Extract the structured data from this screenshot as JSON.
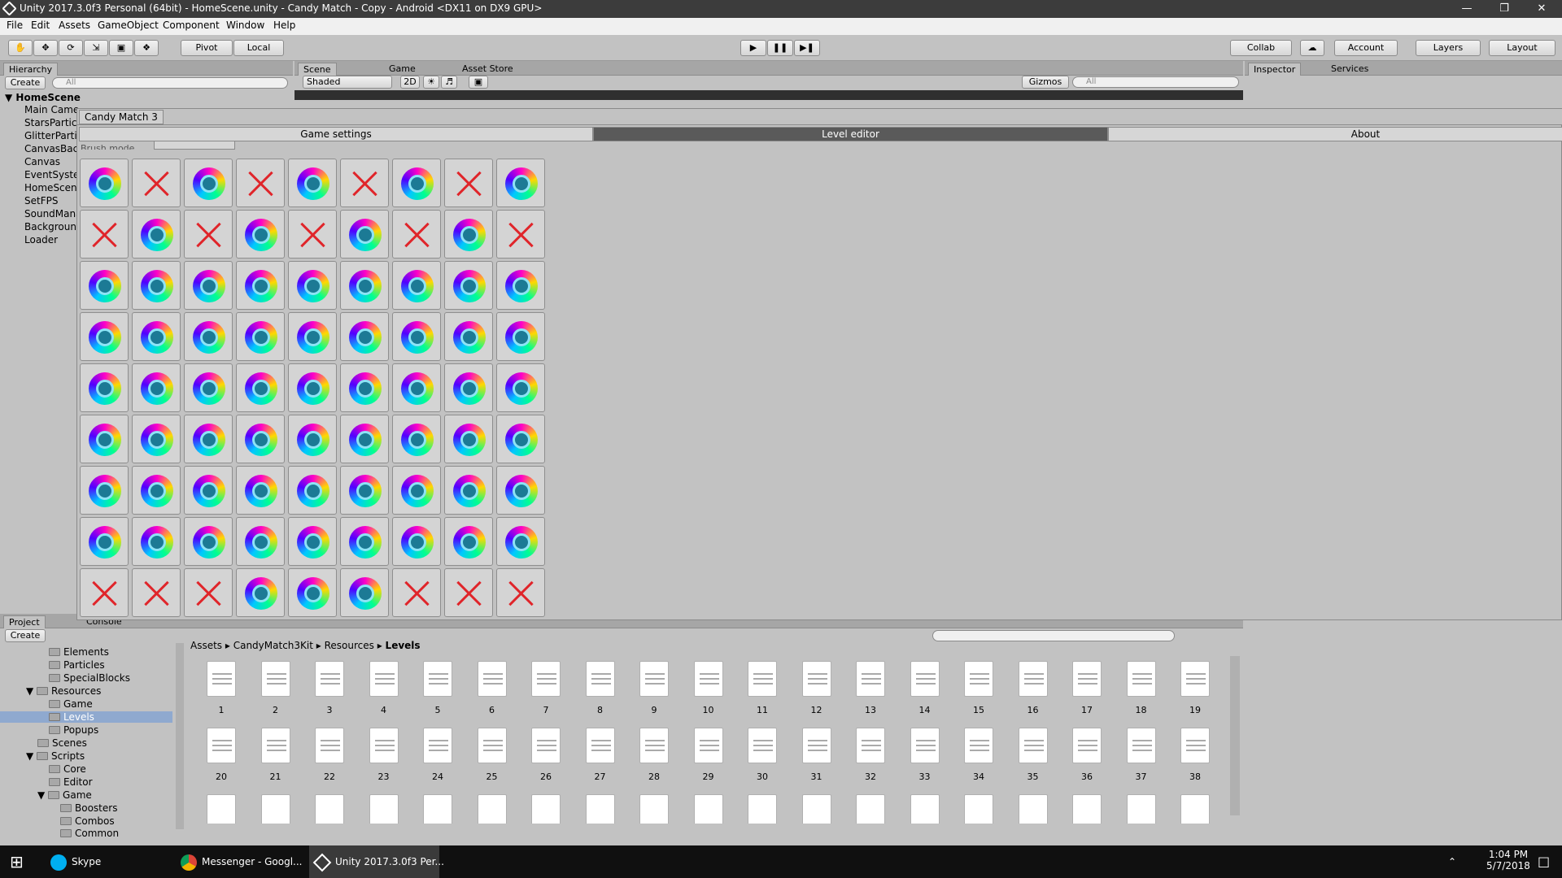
{
  "window": {
    "title": "Unity 2017.3.0f3 Personal (64bit) - HomeScene.unity - Candy Match - Copy - Android <DX11 on DX9 GPU>"
  },
  "menu": [
    "File",
    "Edit",
    "Assets",
    "GameObject",
    "Component",
    "Window",
    "Help"
  ],
  "toolbar": {
    "pivot": "Pivot",
    "local": "Local",
    "collab": "Collab",
    "account": "Account",
    "layers": "Layers",
    "layout": "Layout"
  },
  "hierarchy": {
    "tab": "Hierarchy",
    "create": "Create",
    "search": "All",
    "scene": "HomeScene",
    "items": [
      "Main Came",
      "StarsPartic",
      "GlitterParti",
      "CanvasBac",
      "Canvas",
      "EventSyste",
      "HomeScen",
      "SetFPS",
      "SoundMana",
      "Backgroun",
      "Loader"
    ]
  },
  "scene": {
    "tabs": [
      "Scene",
      "Game",
      "Asset Store"
    ],
    "shading": "Shaded",
    "mode2d": "2D",
    "gizmos": "Gizmos",
    "search": "All"
  },
  "inspector": {
    "tabs": [
      "Inspector",
      "Services"
    ]
  },
  "editor": {
    "title": "Candy Match 3",
    "tabs": [
      "Game settings",
      "Level editor",
      "About"
    ],
    "brush_mode": "Brush mode",
    "grid": [
      [
        "c",
        "x",
        "c",
        "x",
        "c",
        "x",
        "c",
        "x",
        "c"
      ],
      [
        "x",
        "c",
        "x",
        "c",
        "x",
        "c",
        "x",
        "c",
        "x"
      ],
      [
        "c",
        "c",
        "c",
        "c",
        "c",
        "c",
        "c",
        "c",
        "c"
      ],
      [
        "c",
        "c",
        "c",
        "c",
        "c",
        "c",
        "c",
        "c",
        "c"
      ],
      [
        "c",
        "c",
        "c",
        "c",
        "c",
        "c",
        "c",
        "c",
        "c"
      ],
      [
        "c",
        "c",
        "c",
        "c",
        "c",
        "c",
        "c",
        "c",
        "c"
      ],
      [
        "c",
        "c",
        "c",
        "c",
        "c",
        "c",
        "c",
        "c",
        "c"
      ],
      [
        "c",
        "c",
        "c",
        "c",
        "c",
        "c",
        "c",
        "c",
        "c"
      ],
      [
        "x",
        "x",
        "x",
        "c",
        "c",
        "c",
        "x",
        "x",
        "x"
      ]
    ]
  },
  "project": {
    "tabs": [
      "Project",
      "Console"
    ],
    "create": "Create",
    "tree": [
      {
        "label": "Elements",
        "depth": 3
      },
      {
        "label": "Particles",
        "depth": 3
      },
      {
        "label": "SpecialBlocks",
        "depth": 3
      },
      {
        "label": "Resources",
        "depth": 2
      },
      {
        "label": "Game",
        "depth": 3
      },
      {
        "label": "Levels",
        "depth": 3
      },
      {
        "label": "Popups",
        "depth": 3
      },
      {
        "label": "Scenes",
        "depth": 2
      },
      {
        "label": "Scripts",
        "depth": 2
      },
      {
        "label": "Core",
        "depth": 3
      },
      {
        "label": "Editor",
        "depth": 3
      },
      {
        "label": "Game",
        "depth": 3
      },
      {
        "label": "Boosters",
        "depth": 4
      },
      {
        "label": "Combos",
        "depth": 4
      },
      {
        "label": "Common",
        "depth": 4
      }
    ],
    "breadcrumb": [
      "Assets",
      "CandyMatch3Kit",
      "Resources",
      "Levels"
    ],
    "assets_row1": [
      "1",
      "2",
      "3",
      "4",
      "5",
      "6",
      "7",
      "8",
      "9",
      "10",
      "11",
      "12",
      "13",
      "14",
      "15",
      "16",
      "17",
      "18",
      "19"
    ],
    "assets_row2": [
      "20",
      "21",
      "22",
      "23",
      "24",
      "25",
      "26",
      "27",
      "28",
      "29",
      "30",
      "31",
      "32",
      "33",
      "34",
      "35",
      "36",
      "37",
      "38"
    ]
  },
  "taskbar": {
    "skype": "Skype",
    "messenger": "Messenger - Googl...",
    "unity": "Unity 2017.3.0f3 Per...",
    "time": "1:04 PM",
    "date": "5/7/2018"
  }
}
